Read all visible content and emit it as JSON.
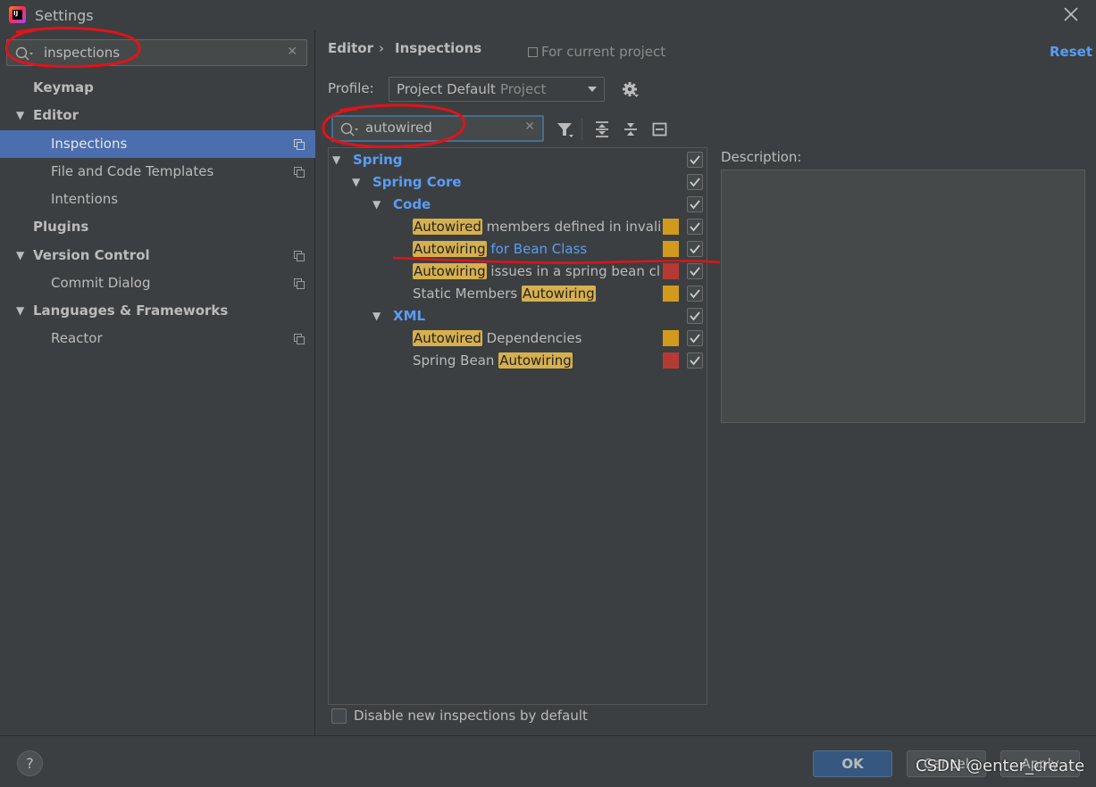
{
  "window": {
    "title": "Settings"
  },
  "left": {
    "search_value": "inspections",
    "items": [
      {
        "label": "Keymap"
      },
      {
        "label": "Editor"
      },
      {
        "label": "Inspections"
      },
      {
        "label": "File and Code Templates"
      },
      {
        "label": "Intentions"
      },
      {
        "label": "Plugins"
      },
      {
        "label": "Version Control"
      },
      {
        "label": "Commit Dialog"
      },
      {
        "label": "Languages & Frameworks"
      },
      {
        "label": "Reactor"
      }
    ]
  },
  "header": {
    "crumb1": "Editor",
    "separator": "›",
    "crumb2": "Inspections",
    "scope": "For current project",
    "reset": "Reset"
  },
  "profile": {
    "label": "Profile:",
    "value": "Project Default",
    "scope": "Project"
  },
  "filter": {
    "value": "autowired"
  },
  "tree": {
    "spring": "Spring",
    "spring_core": "Spring Core",
    "code": "Code",
    "xml": "XML",
    "rows": [
      {
        "hl": "Autowired",
        "rest": "members defined in invalid",
        "severity_color": "#d19a1c"
      },
      {
        "hl": "Autowiring",
        "rest": "for Bean Class",
        "severity_color": "#d19a1c"
      },
      {
        "hl": "Autowiring",
        "rest": "issues in a spring bean clas",
        "severity_color": "#b63a34"
      },
      {
        "pre": "Static Members",
        "hl": "Autowiring",
        "severity_color": "#d19a1c"
      },
      {
        "hl": "Autowired",
        "rest": "Dependencies",
        "severity_color": "#d19a1c"
      },
      {
        "pre": "Spring Bean",
        "hl": "Autowiring",
        "severity_color": "#b63a34"
      }
    ]
  },
  "description_label": "Description:",
  "disable_label": "Disable new inspections by default",
  "buttons": {
    "ok": "OK",
    "cancel": "Cancel",
    "apply": "Apply",
    "help": "?"
  },
  "watermark": "CSDN @enter_create",
  "colors": {
    "accent": "#589df6",
    "selection": "#4b6eaf",
    "highlight": "#d6b04e",
    "annotation": "#e0131a"
  }
}
